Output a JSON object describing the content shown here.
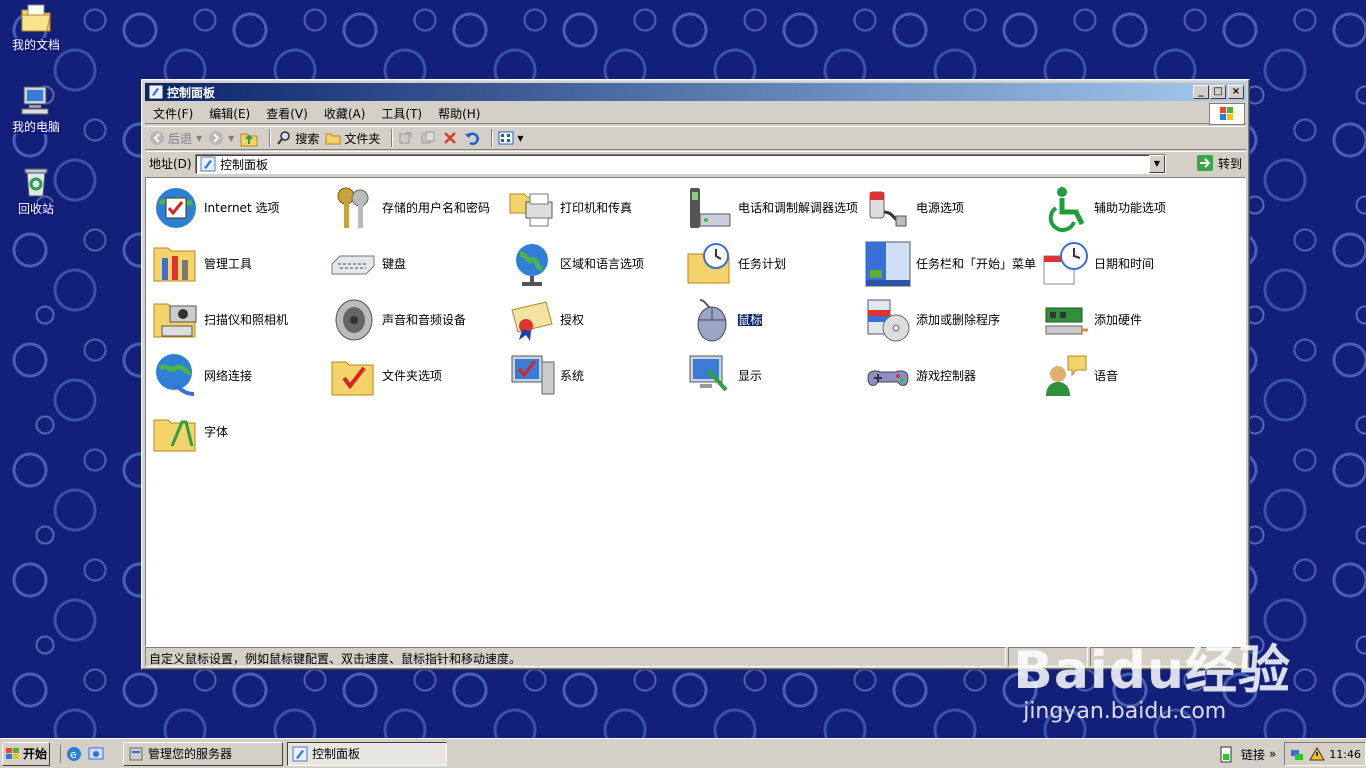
{
  "desktop": {
    "icons": [
      {
        "label": "我的文档",
        "icon": "my-documents-icon"
      },
      {
        "label": "我的电脑",
        "icon": "my-computer-icon"
      },
      {
        "label": "回收站",
        "icon": "recycle-bin-icon"
      }
    ]
  },
  "window": {
    "title": "控制面板",
    "buttons": {
      "minimize": "_",
      "maximize": "□",
      "close": "×"
    },
    "menu": [
      "文件(F)",
      "编辑(E)",
      "查看(V)",
      "收藏(A)",
      "工具(T)",
      "帮助(H)"
    ],
    "toolbar": {
      "back": "后退",
      "search": "搜索",
      "folders": "文件夹"
    },
    "address": {
      "label": "地址(D)",
      "value": "控制面板",
      "go": "转到"
    },
    "items": [
      {
        "label": "Internet 选项",
        "icon": "internet-options-icon"
      },
      {
        "label": "存储的用户名和密码",
        "icon": "stored-passwords-icon"
      },
      {
        "label": "打印机和传真",
        "icon": "printers-faxes-icon"
      },
      {
        "label": "电话和调制解调器选项",
        "icon": "phone-modem-icon"
      },
      {
        "label": "电源选项",
        "icon": "power-options-icon"
      },
      {
        "label": "辅助功能选项",
        "icon": "accessibility-icon"
      },
      {
        "label": "管理工具",
        "icon": "admin-tools-icon"
      },
      {
        "label": "键盘",
        "icon": "keyboard-icon"
      },
      {
        "label": "区域和语言选项",
        "icon": "regional-language-icon"
      },
      {
        "label": "任务计划",
        "icon": "scheduled-tasks-icon"
      },
      {
        "label": "任务栏和「开始」菜单",
        "icon": "taskbar-start-menu-icon"
      },
      {
        "label": "日期和时间",
        "icon": "date-time-icon"
      },
      {
        "label": "扫描仪和照相机",
        "icon": "scanner-camera-icon"
      },
      {
        "label": "声音和音频设备",
        "icon": "sound-audio-icon"
      },
      {
        "label": "授权",
        "icon": "licensing-icon"
      },
      {
        "label": "鼠标",
        "icon": "mouse-icon",
        "selected": true
      },
      {
        "label": "添加或删除程序",
        "icon": "add-remove-programs-icon"
      },
      {
        "label": "添加硬件",
        "icon": "add-hardware-icon"
      },
      {
        "label": "网络连接",
        "icon": "network-connections-icon"
      },
      {
        "label": "文件夹选项",
        "icon": "folder-options-icon"
      },
      {
        "label": "系统",
        "icon": "system-icon"
      },
      {
        "label": "显示",
        "icon": "display-icon"
      },
      {
        "label": "游戏控制器",
        "icon": "game-controllers-icon"
      },
      {
        "label": "语音",
        "icon": "speech-icon"
      },
      {
        "label": "字体",
        "icon": "fonts-icon"
      }
    ],
    "status": "自定义鼠标设置，例如鼠标键配置、双击速度、鼠标指针和移动速度。"
  },
  "taskbar": {
    "start": "开始",
    "tasks": [
      {
        "label": "管理您的服务器",
        "active": false
      },
      {
        "label": "控制面板",
        "active": true
      }
    ],
    "links": "链接",
    "chevron": "»",
    "clock": "11:46"
  },
  "watermark": {
    "brand": "Baidu经验",
    "url": "jingyan.baidu.com"
  },
  "colors": {
    "titlebar_start": "#0a246a",
    "titlebar_end": "#a6caf0",
    "desktop": "#12207a",
    "face": "#d4d0c8"
  }
}
